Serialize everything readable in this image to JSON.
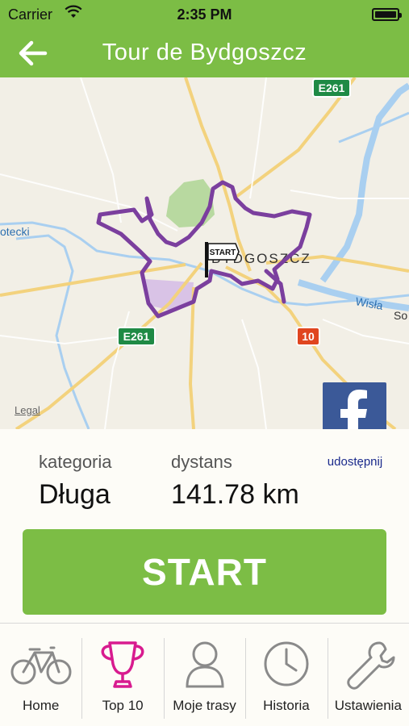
{
  "status_bar": {
    "carrier": "Carrier",
    "time": "2:35 PM",
    "battery_level_percent": 85
  },
  "nav": {
    "title": "Tour de Bydgoszcz",
    "back_icon": "arrow-left-icon"
  },
  "map": {
    "route_color": "#7b3f9e",
    "city_label": "BYDGOSZCZ",
    "start_flag_label": "START",
    "river_label": "Wisła",
    "west_label": "otecki",
    "east_label": "So",
    "road_shields": [
      "E261",
      "E261",
      "10"
    ],
    "legal_label": "Legal",
    "facebook_icon": "facebook-icon"
  },
  "details": {
    "category_label": "kategoria",
    "category_value": "Długa",
    "distance_label": "dystans",
    "distance_value": "141.78 km",
    "share_label": "udostępnij"
  },
  "start_button": {
    "label": "START"
  },
  "tabs": [
    {
      "label": "Home",
      "icon": "bicycle-icon",
      "active": false
    },
    {
      "label": "Top 10",
      "icon": "trophy-icon",
      "active": true
    },
    {
      "label": "Moje trasy",
      "icon": "user-icon",
      "active": false
    },
    {
      "label": "Historia",
      "icon": "clock-icon",
      "active": false
    },
    {
      "label": "Ustawienia",
      "icon": "wrench-icon",
      "active": false
    }
  ],
  "colors": {
    "brand_green": "#7cbd45",
    "tab_active": "#d81b8f",
    "tab_inactive": "#8a8a8a",
    "facebook_blue": "#3b5998"
  }
}
